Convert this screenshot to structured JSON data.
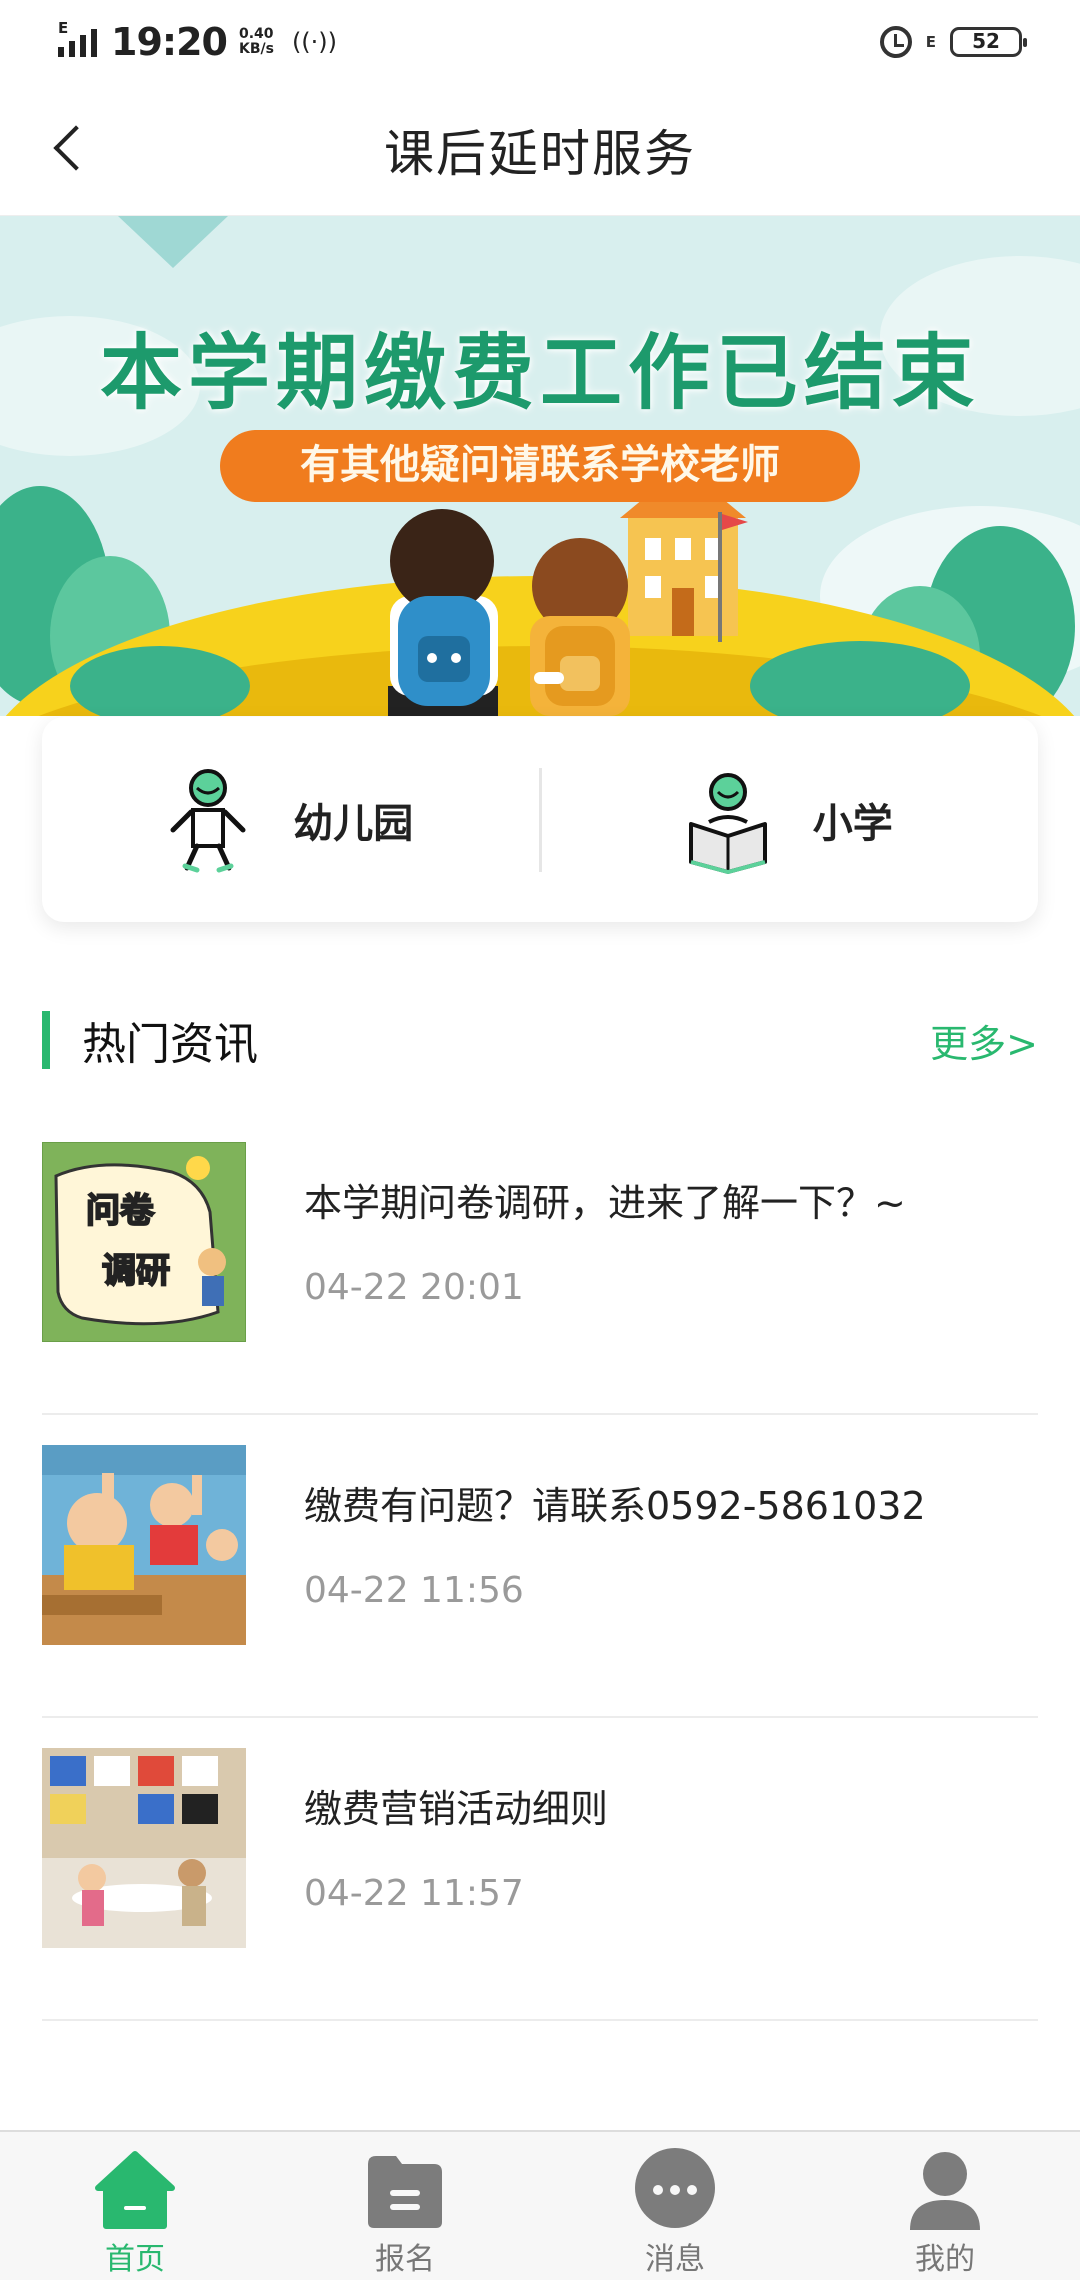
{
  "status_bar": {
    "network_type": "E",
    "time": "19:20",
    "speed_value": "0.40",
    "speed_unit": "KB/s",
    "network_type_right": "E",
    "battery": "52"
  },
  "header": {
    "title": "课后延时服务"
  },
  "banner": {
    "headline": "本学期缴费工作已结束",
    "subline": "有其他疑问请联系学校老师"
  },
  "categories": [
    {
      "label": "幼儿园",
      "icon": "kindergarten-child-icon"
    },
    {
      "label": "小学",
      "icon": "student-reading-icon"
    }
  ],
  "hot_news": {
    "title": "热门资讯",
    "more": "更多>",
    "items": [
      {
        "title": "本学期问卷调研，进来了解一下？~",
        "date": "04-22 20:01",
        "thumb_text": [
          "问卷",
          "调研"
        ]
      },
      {
        "title": "缴费有问题？请联系0592-5861032",
        "date": "04-22 11:56"
      },
      {
        "title": "缴费营销活动细则",
        "date": "04-22 11:57"
      }
    ]
  },
  "tabbar": {
    "items": [
      {
        "label": "首页",
        "icon": "home-icon",
        "active": true
      },
      {
        "label": "报名",
        "icon": "folder-icon",
        "active": false
      },
      {
        "label": "消息",
        "icon": "chat-bubble-icon",
        "active": false
      },
      {
        "label": "我的",
        "icon": "person-icon",
        "active": false
      }
    ]
  },
  "colors": {
    "accent": "#29b86f",
    "banner_sky": "#d8efee",
    "ribbon": "#f07c1e",
    "banner_text": "#1d9a6c"
  }
}
